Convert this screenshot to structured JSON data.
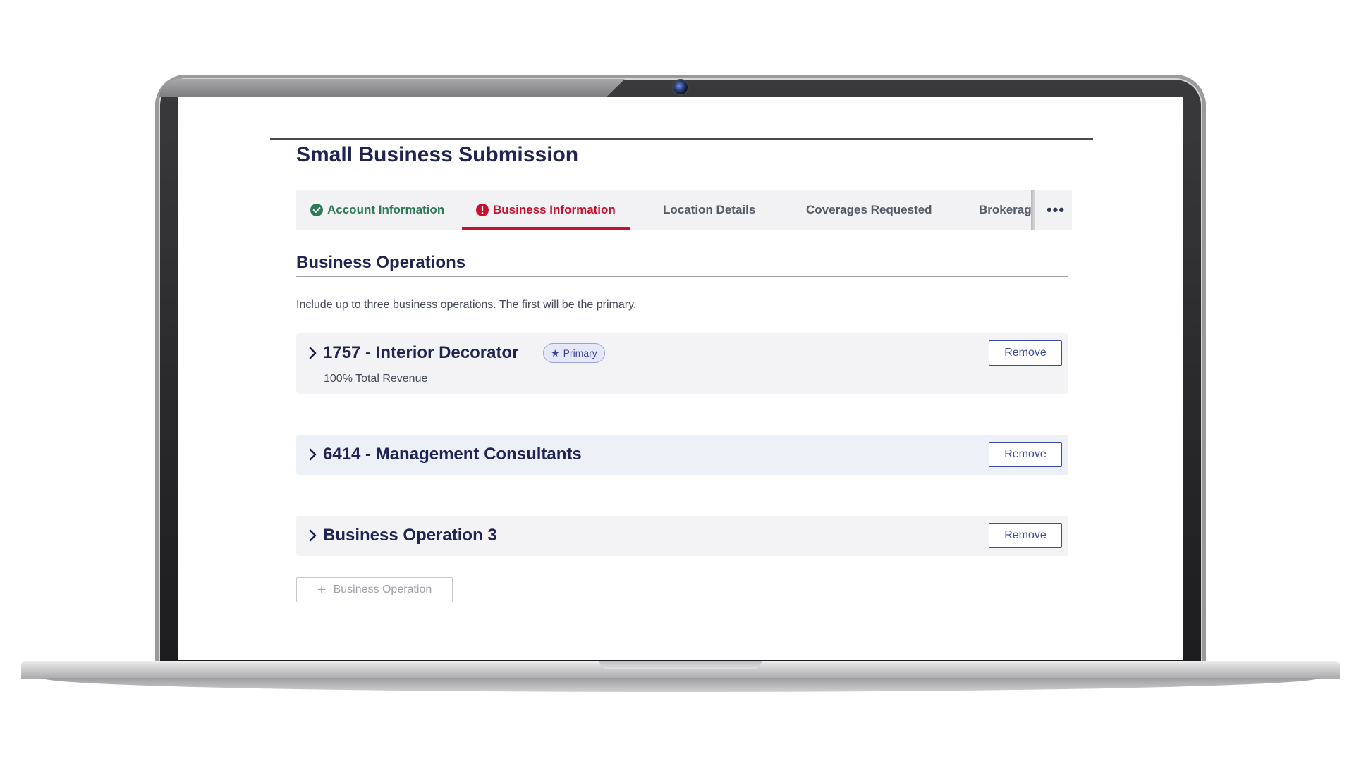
{
  "page": {
    "title": "Small Business Submission"
  },
  "tabs": [
    {
      "label": "Account Information",
      "status": "complete",
      "icon": "check-circle-icon"
    },
    {
      "label": "Business Information",
      "status": "error",
      "icon": "alert-circle-icon",
      "active": true
    },
    {
      "label": "Location Details"
    },
    {
      "label": "Coverages Requested"
    },
    {
      "label": "Brokerage"
    }
  ],
  "tabs_more_label": "•••",
  "section": {
    "title": "Business Operations",
    "description": "Include up to three business operations. The first will be the primary."
  },
  "operations": [
    {
      "name": "1757 - Interior Decorator",
      "badge": "Primary",
      "revenue": "100% Total Revenue",
      "remove_label": "Remove"
    },
    {
      "name": "6414 - Management Consultants",
      "remove_label": "Remove"
    },
    {
      "name": "Business Operation 3",
      "remove_label": "Remove"
    }
  ],
  "add_button": {
    "label": "Business Operation",
    "icon": "plus-icon"
  },
  "colors": {
    "title": "#1f2452",
    "success": "#2e7a57",
    "error": "#c8102e",
    "accent": "#3e4a9e"
  }
}
